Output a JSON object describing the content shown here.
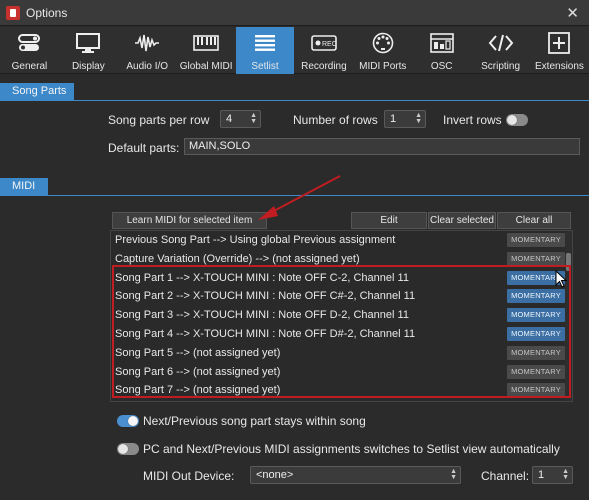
{
  "window": {
    "title": "Options",
    "close_glyph": "✕"
  },
  "toolbar": {
    "active_tab": "Setlist",
    "items": [
      {
        "label": "General",
        "icon": "toggles-icon"
      },
      {
        "label": "Display",
        "icon": "monitor-icon"
      },
      {
        "label": "Audio I/O",
        "icon": "waveform-icon"
      },
      {
        "label": "Global MIDI",
        "icon": "keyboard-icon"
      },
      {
        "label": "Setlist",
        "icon": "list-icon"
      },
      {
        "label": "Recording",
        "icon": "rec-icon"
      },
      {
        "label": "MIDI Ports",
        "icon": "midi-port-icon"
      },
      {
        "label": "OSC",
        "icon": "osc-icon"
      },
      {
        "label": "Scripting",
        "icon": "code-icon"
      },
      {
        "label": "Extensions",
        "icon": "plus-box-icon"
      }
    ]
  },
  "song_parts": {
    "header": "Song Parts",
    "per_row_label": "Song parts per row",
    "per_row_value": "4",
    "rows_label": "Number of rows",
    "rows_value": "1",
    "invert_label": "Invert rows",
    "invert_on": false,
    "default_label": "Default parts:",
    "default_value": "MAIN,SOLO"
  },
  "midi": {
    "header": "MIDI",
    "learn_button": "Learn MIDI for selected item",
    "edit_button": "Edit",
    "clear_selected_button": "Clear selected",
    "clear_all_button": "Clear all",
    "rows": [
      {
        "text": "Previous Song Part --> Using global Previous assignment",
        "badge": "MOMENTARY",
        "badge_style": "grey"
      },
      {
        "text": "Capture Variation (Override) --> (not assigned yet)",
        "badge": "MOMENTARY",
        "badge_style": "grey"
      },
      {
        "text": "Song Part 1 --> X-TOUCH MINI : Note OFF C-2, Channel 11",
        "badge": "MOMENTARY",
        "badge_style": "blue"
      },
      {
        "text": "Song Part 2 --> X-TOUCH MINI : Note OFF C#-2, Channel 11",
        "badge": "MOMENTARY",
        "badge_style": "blue"
      },
      {
        "text": "Song Part 3 --> X-TOUCH MINI : Note OFF D-2, Channel 11",
        "badge": "MOMENTARY",
        "badge_style": "blue"
      },
      {
        "text": "Song Part 4 --> X-TOUCH MINI : Note OFF D#-2, Channel 11",
        "badge": "MOMENTARY",
        "badge_style": "blue"
      },
      {
        "text": "Song Part 5 --> (not assigned yet)",
        "badge": "MOMENTARY",
        "badge_style": "grey"
      },
      {
        "text": "Song Part 6 --> (not assigned yet)",
        "badge": "MOMENTARY",
        "badge_style": "grey"
      },
      {
        "text": "Song Part 7 --> (not assigned yet)",
        "badge": "MOMENTARY",
        "badge_style": "grey"
      }
    ],
    "stay_within_label": "Next/Previous song part stays within song",
    "stay_within_on": true,
    "switch_view_label": "PC and Next/Previous MIDI assignments switches to Setlist view automatically",
    "switch_view_on": false,
    "out_device_label": "MIDI Out Device:",
    "out_device_value": "<none>",
    "channel_label": "Channel:",
    "channel_value": "1"
  },
  "colors": {
    "accent": "#3c88c9",
    "annotation_red": "#c01d22",
    "badge_blue": "#3b6fa4",
    "background": "#2b2b2b"
  }
}
